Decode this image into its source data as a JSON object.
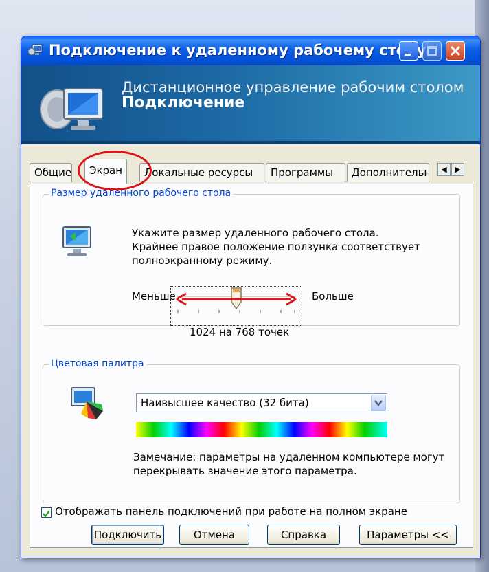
{
  "window": {
    "title": "Подключение к удаленному рабочему столу",
    "banner_line1": "Дистанционное управление рабочим столом",
    "banner_line2": "Подключение"
  },
  "tabs": [
    "Общие",
    "Экран",
    "Локальные ресурсы",
    "Программы",
    "Дополнительно"
  ],
  "active_tab": "Экран",
  "display_size_group": {
    "title": "Размер удаленного рабочего стола",
    "description": [
      "Укажите размер удаленного рабочего стола.",
      "Крайнее правое положение ползунка соответствует",
      "полноэкранному режиму."
    ],
    "less_label": "Меньше",
    "more_label": "Больше",
    "resolution_text": "1024 на 768 точек",
    "slider_position_fraction": 0.5
  },
  "color_group": {
    "title": "Цветовая палитра",
    "selected_value": "Наивысшее качество (32 бита)",
    "note": [
      "Замечание: параметры на удаленном компьютере могут",
      "перекрывать значение этого параметра."
    ]
  },
  "connection_bar_checkbox": {
    "checked": true,
    "label": "Отображать панель подключений при работе на полном экране"
  },
  "buttons": {
    "connect": "Подключить",
    "cancel": "Отмена",
    "help": "Справка",
    "options": "Параметры <<"
  },
  "colors": {
    "titlebar": "#0352d8",
    "banner": "#1d6aa5",
    "highlight": "#e01515",
    "group_title": "#0046d5"
  }
}
